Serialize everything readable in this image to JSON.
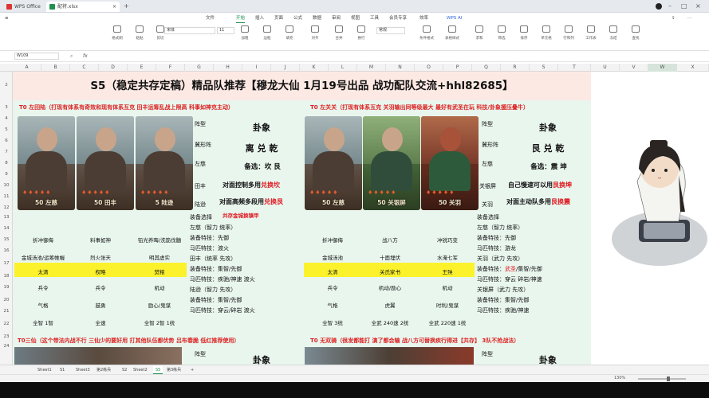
{
  "window": {
    "tabs": [
      {
        "label": "WPS Office",
        "active": false
      },
      {
        "label": "配将.xlsx",
        "active": true
      }
    ],
    "add_tab": "+",
    "brand_color": "#1f8f4e"
  },
  "menu": [
    "文件",
    "开始",
    "插入",
    "页面",
    "公式",
    "数据",
    "审阅",
    "视图",
    "工具",
    "会员专享",
    "效率",
    "WPS AI"
  ],
  "active_menu": "开始",
  "toolbar": {
    "font_name": "宋体",
    "font_size": "11",
    "tools": [
      "格式刷",
      "粘贴",
      "剪切",
      "复制",
      "加粗",
      "字体",
      "边框",
      "填充",
      "对齐",
      "合并",
      "换行",
      "常规",
      "条件格式",
      "表格样式",
      "求和",
      "筛选",
      "排序",
      "填充",
      "单元格",
      "行和列",
      "工作表",
      "冻结",
      "查找"
    ]
  },
  "formula": {
    "name_box": "W109",
    "fx": "fx",
    "value": ""
  },
  "columns": [
    "A",
    "B",
    "C",
    "D",
    "E",
    "F",
    "G",
    "H",
    "I",
    "J",
    "K",
    "L",
    "M",
    "N",
    "O",
    "P",
    "Q",
    "R",
    "S",
    "T",
    "U",
    "V",
    "W",
    "X"
  ],
  "selected_column": "W",
  "rows": [
    "2",
    "3",
    "4",
    "5",
    "6",
    "7",
    "8",
    "9",
    "10",
    "11",
    "12",
    "13",
    "14",
    "15",
    "16",
    "17",
    "18",
    "19",
    "20",
    "21",
    "22",
    "23",
    "24",
    "25",
    "26",
    "27"
  ],
  "sheet": {
    "title": "S5（稳定共存定稿）精品队推荐【穆龙大仙 1月19号出品 战功配队交流+hhl82685】",
    "left": {
      "team": "T0 左田陆（打现有体系有奇效和现有体系互克 田丰运筹乱战上限高 科事如神克主动）",
      "heroes": [
        "50 左慈",
        "50 田丰",
        "5 陆逊"
      ],
      "zhenxing_label": "阵型",
      "zhenxing": "卦象",
      "zhenfa_label": "冀形阵",
      "zhenfa": "离 兑 乾",
      "beixuan_label": "左慈",
      "beixuan": "备选：坎 艮",
      "line1_label": "田丰",
      "line1_pre": "对面控制多用",
      "line1_red": "兑换坎",
      "line2_label": "陆逊",
      "line2_pre": "对面高频多段用",
      "line2_red": "兑换艮",
      "note_red": "共存金城换镇甲",
      "skill_rows": [
        [
          "折冲御侮",
          "料事如神",
          "铅光养晦/洗筋伐髓"
        ],
        [
          "金城汤池/运筹帷幄",
          "烈火张天",
          "明其虚实"
        ],
        [
          "太清",
          "权略",
          "焚粮"
        ],
        [
          "兵令",
          "兵令",
          "机动"
        ],
        [
          "气格",
          "鼓勇",
          "励心/鬼谋"
        ],
        [
          "全智 1智",
          "全速",
          "全智 2智 1统"
        ]
      ],
      "equip": [
        "装备选择",
        "左慈（智力 统率）",
        "装备特技：先御",
        "马匹特技：渡火",
        "田丰（统率 先攻）",
        "装备特技：集智/先御",
        "马匹特技：疾驰/神速 渡火",
        "陆逊（智力 先攻）",
        "装备特技：集智/先御",
        "马匹特技：穿云/碎岩 渡火"
      ]
    },
    "right": {
      "team": "T0 左关关（打现有体系互克 关羽输出同等级最大 最好有武圣在玩 科技/卦象援压叠牛）",
      "heroes": [
        "50 左慈",
        "50 关银屏",
        "50 关羽"
      ],
      "zhenxing_label": "阵型",
      "zhenxing": "卦象",
      "zhenfa_label": "冀形阵",
      "zhenfa": "艮 兑 乾",
      "beixuan_label": "左慈",
      "beixuan": "备选：震 坤",
      "line1_label": "关银屏",
      "line1_pre": "自己慢速可以用",
      "line1_red": "艮换坤",
      "line2_label": "关羽",
      "line2_pre": "对面主动队多用",
      "line2_red": "艮换震",
      "skill_rows": [
        [
          "折冲御侮",
          "战八方",
          "冲锐巧变"
        ],
        [
          "金城汤池",
          "十面埋伏",
          "水淹七军"
        ],
        [
          "太清",
          "关氏家书",
          "王殃"
        ],
        [
          "兵令",
          "机动/励心",
          "机动"
        ],
        [
          "气格",
          "虎翼",
          "时利/鬼谋"
        ],
        [
          "全智 3统",
          "全武 240速 2统",
          "全武 220速 1统"
        ]
      ],
      "equip": [
        "装备选择",
        "左慈（智力 统率）",
        "装备特技：先御",
        "马匹特技：游龙",
        "关羽（武力 先攻）",
        "装备特技：",
        "马匹特技：穿云 碎岩/神速",
        "关银屏（武力 先攻）",
        "装备特技：集智/先御",
        "马匹特技：疾驰/神速"
      ],
      "equip_red": "武圣"
    },
    "bottom_left": "T0三仙（这个带法内战不行 三仙少的要好用 打其他队伍都优势 吕布春脆 低红推荐使用）",
    "bottom_right": "T0 无双骑（很发都能打 演了都会输 战八方可替换疾行得进【共存】 3队不抢战法）",
    "bottom_zhenxing_label": "阵型",
    "bottom_zhenxing": "卦象",
    "colors": {
      "title_bg": "#fde9e4",
      "panel_bg": "#e9f6ee",
      "highlight": "#fbf22c",
      "accent_red": "#e0171f"
    }
  },
  "sheet_tabs": [
    "Sheet1",
    "S1",
    "Sheet3",
    "第2练兵",
    "S2",
    "Sheet2",
    "S5",
    "第3练兵",
    "+"
  ],
  "active_sheet": "S5",
  "status": {
    "zoom": "130%"
  }
}
